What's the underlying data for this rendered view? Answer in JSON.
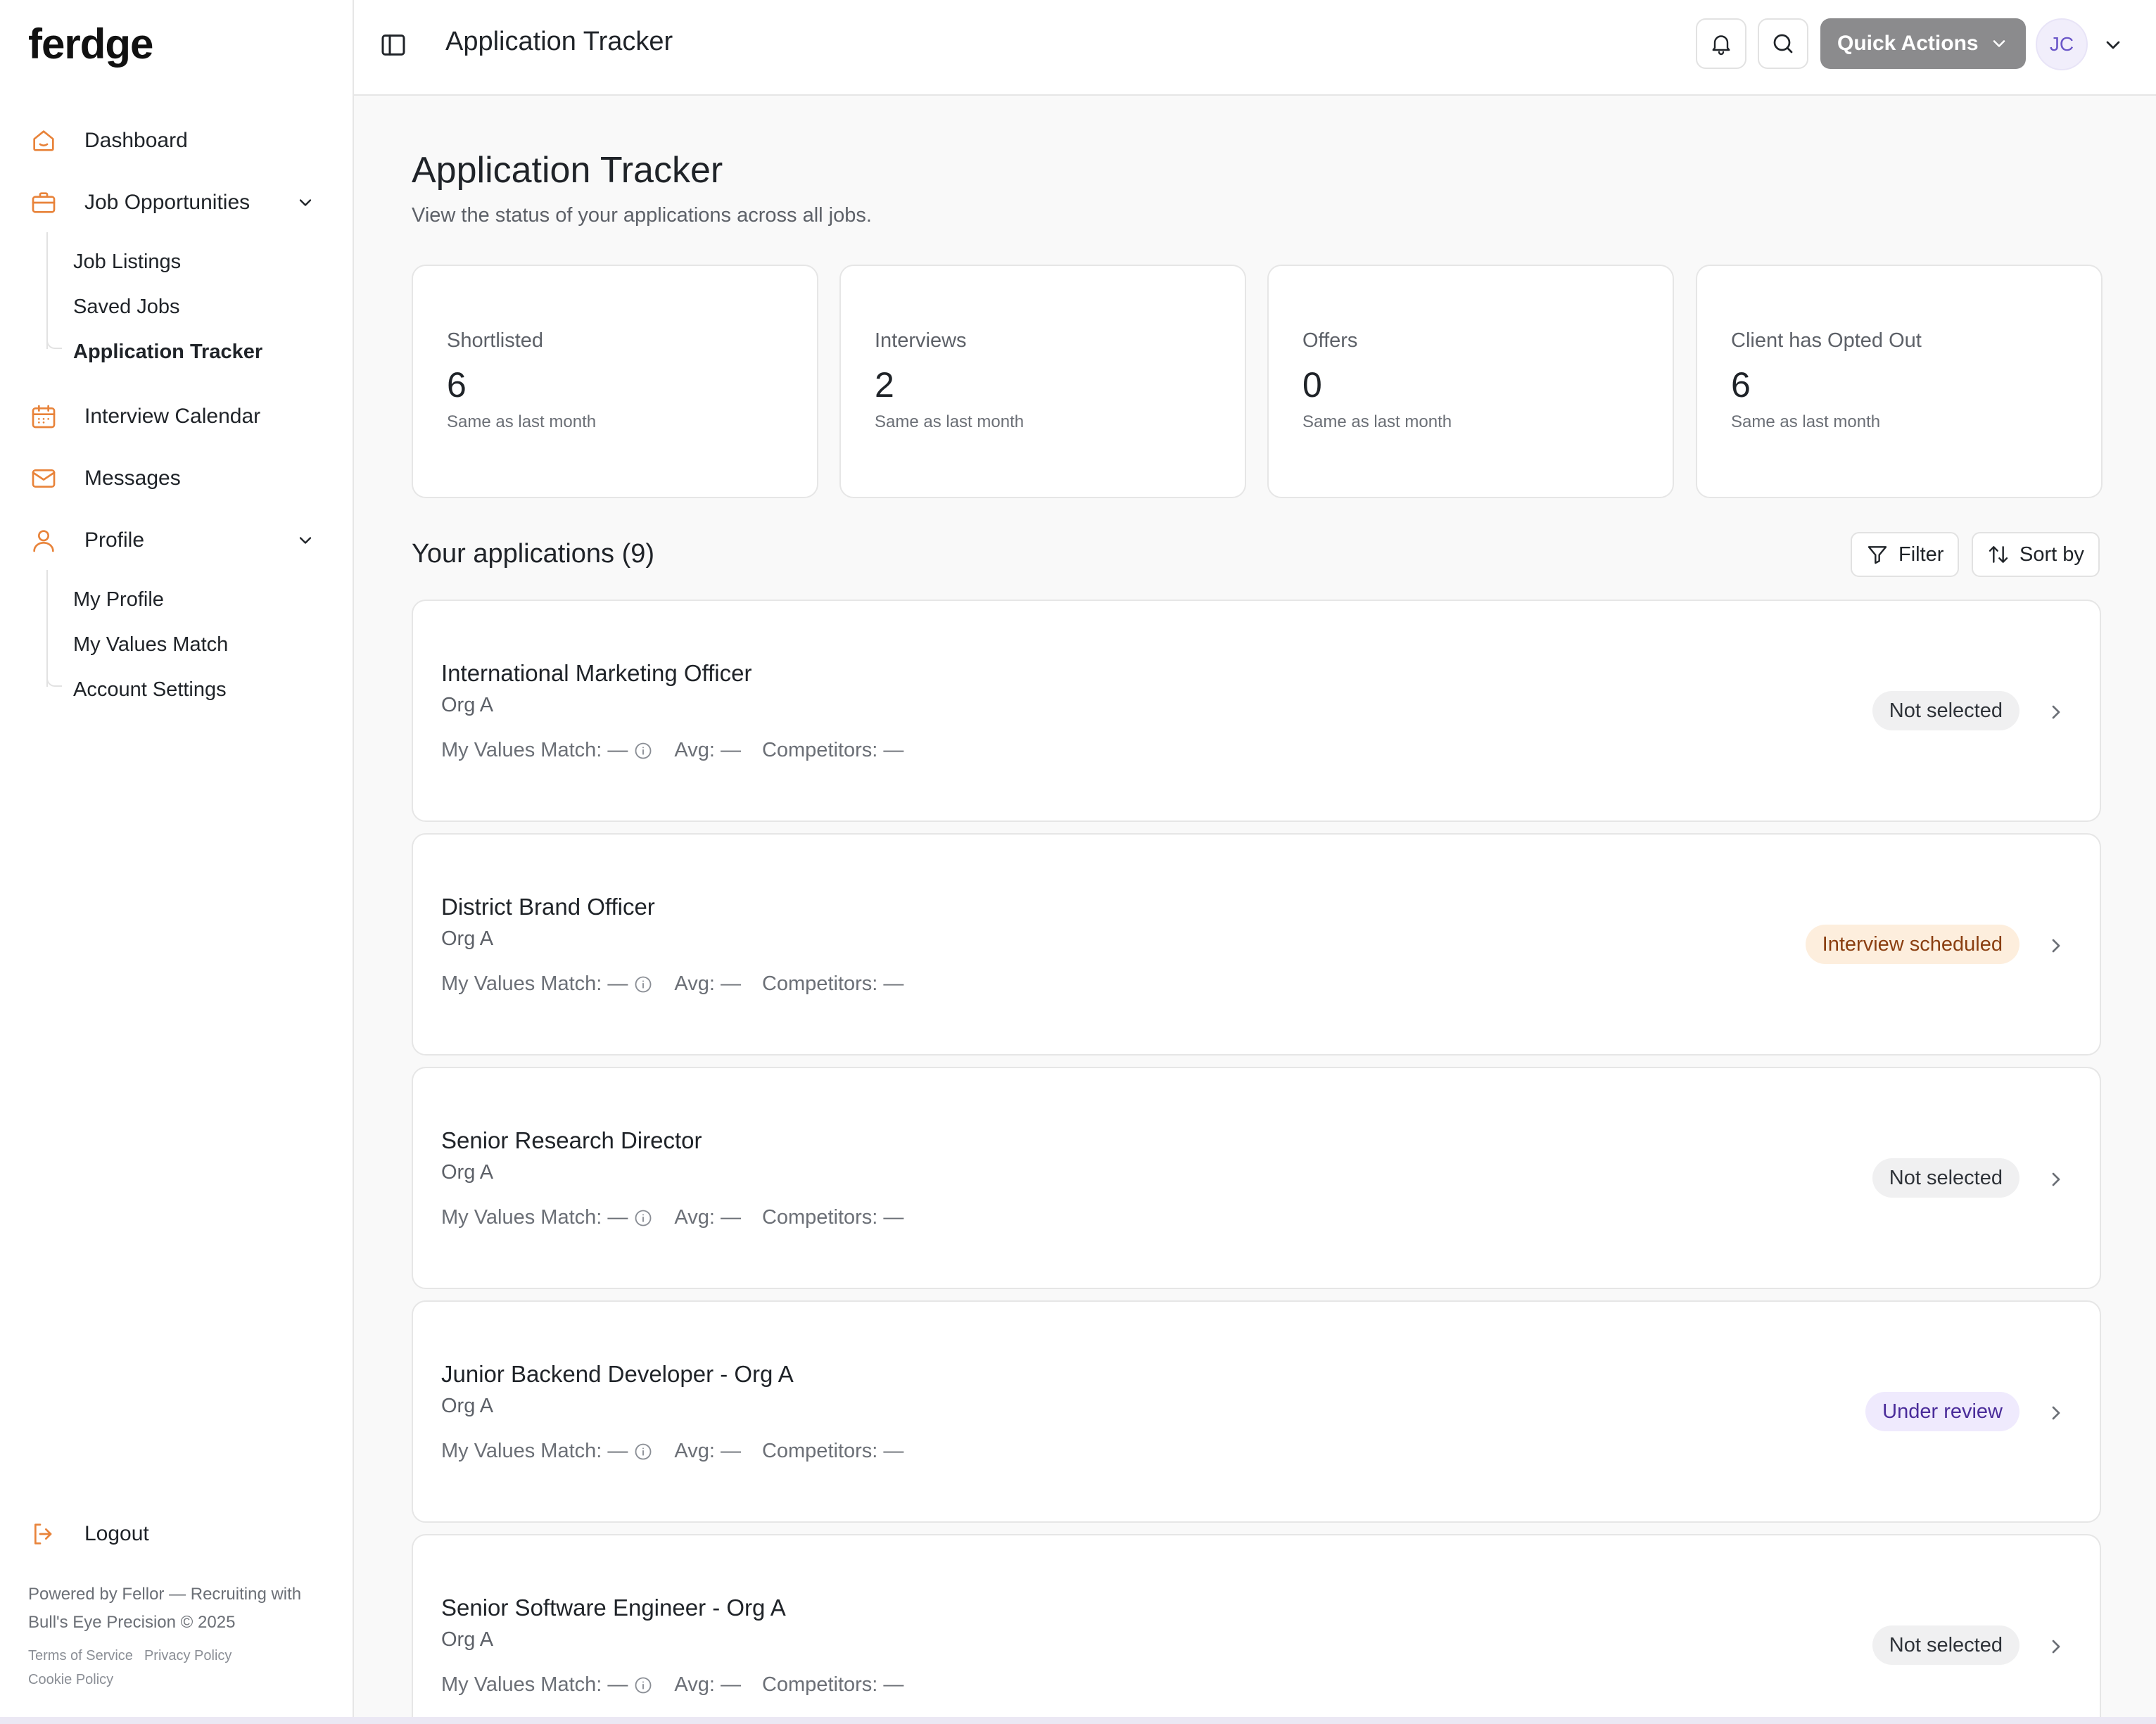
{
  "brand": {
    "logo": "ferdge"
  },
  "sidebar": {
    "items": [
      {
        "label": "Dashboard",
        "icon": "home-icon"
      },
      {
        "label": "Job Opportunities",
        "icon": "briefcase-icon"
      },
      {
        "label": "Interview Calendar",
        "icon": "calendar-icon"
      },
      {
        "label": "Messages",
        "icon": "mail-icon"
      },
      {
        "label": "Profile",
        "icon": "user-icon"
      }
    ],
    "job_sub": [
      "Job Listings",
      "Saved Jobs",
      "Application Tracker"
    ],
    "profile_sub": [
      "My Profile",
      "My Values Match",
      "Account Settings"
    ],
    "logout": "Logout",
    "footer": "Powered by Fellor — Recruiting with Bull's Eye Precision © 2025",
    "links": [
      "Terms of Service",
      "Privacy Policy",
      "Cookie Policy"
    ]
  },
  "topbar": {
    "title": "Application Tracker",
    "quick_actions": "Quick Actions",
    "avatar": "JC"
  },
  "page": {
    "title": "Application Tracker",
    "subtitle": "View the status of your applications across all jobs."
  },
  "stats": [
    {
      "label": "Shortlisted",
      "value": "6",
      "note": "Same as last month"
    },
    {
      "label": "Interviews",
      "value": "2",
      "note": "Same as last month"
    },
    {
      "label": "Offers",
      "value": "0",
      "note": "Same as last month"
    },
    {
      "label": "Client has Opted Out",
      "value": "6",
      "note": "Same as last month"
    }
  ],
  "list": {
    "title": "Your applications (9)",
    "filter": "Filter",
    "sort": "Sort by"
  },
  "meta_labels": {
    "values": "My Values Match: —",
    "avg": "Avg: —",
    "competitors": "Competitors: —"
  },
  "applications": [
    {
      "title": "International Marketing Officer",
      "org": "Org A",
      "status": "Not selected"
    },
    {
      "title": "District Brand Officer",
      "org": "Org A",
      "status": "Interview scheduled"
    },
    {
      "title": "Senior Research Director",
      "org": "Org A",
      "status": "Not selected"
    },
    {
      "title": "Junior Backend Developer - Org A",
      "org": "Org A",
      "status": "Under review"
    },
    {
      "title": "Senior Software Engineer - Org A",
      "org": "Org A",
      "status": "Not selected"
    }
  ],
  "colors": {
    "accent": "#e8833a",
    "status_neutral_bg": "#f0f0f1",
    "status_interview_bg": "#fdeedd",
    "status_review_bg": "#efeafd"
  }
}
